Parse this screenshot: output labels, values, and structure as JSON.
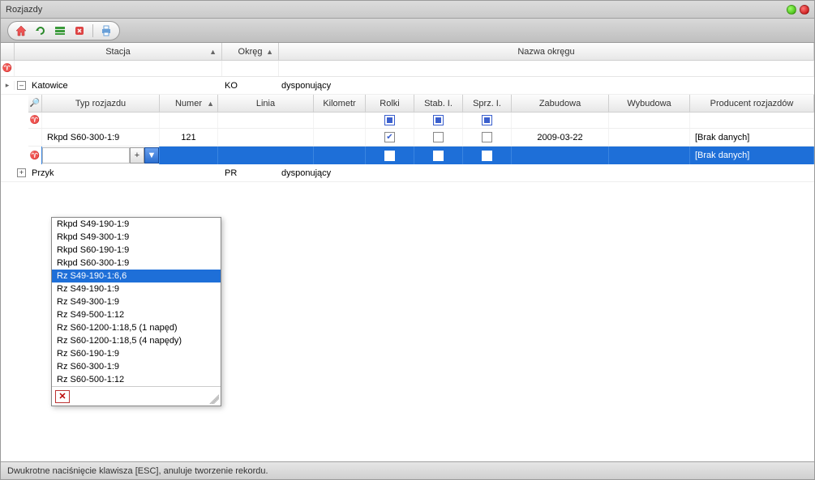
{
  "window": {
    "title": "Rozjazdy"
  },
  "outer_columns": {
    "stacja": "Stacja",
    "okreg": "Okręg",
    "nazwa": "Nazwa okręgu"
  },
  "groups": [
    {
      "label": "Katowice",
      "okreg": "KO",
      "nazwa": "dysponujący",
      "expanded": true
    },
    {
      "label": "Przyk",
      "okreg": "PR",
      "nazwa": "dysponujący",
      "expanded": false
    }
  ],
  "inner_columns": {
    "typ": "Typ rozjazdu",
    "numer": "Numer",
    "linia": "Linia",
    "km": "Kilometr",
    "rolki": "Rolki",
    "stab": "Stab. I.",
    "sprz": "Sprz. I.",
    "zabudowa": "Zabudowa",
    "wybudowa": "Wybudowa",
    "producent": "Producent rozjazdów"
  },
  "row1": {
    "typ": "Rkpd S60-300-1:9",
    "numer": "121",
    "linia": "",
    "km": "",
    "rolki": true,
    "stab": false,
    "sprz": false,
    "zabudowa": "2009-03-22",
    "wybudowa": "",
    "producent": "[Brak danych]"
  },
  "edit_row": {
    "producent": "[Brak danych]"
  },
  "dropdown": {
    "items": [
      "Rkpd S49-190-1:9",
      "Rkpd S49-300-1:9",
      "Rkpd S60-190-1:9",
      "Rkpd S60-300-1:9",
      "Rz S49-190-1:6,6",
      "Rz S49-190-1:9",
      "Rz S49-300-1:9",
      "Rz S49-500-1:12",
      "Rz S60-1200-1:18,5 (1 napęd)",
      "Rz S60-1200-1:18,5 (4 napędy)",
      "Rz S60-190-1:9",
      "Rz S60-300-1:9",
      "Rz S60-500-1:12"
    ],
    "selected_index": 4
  },
  "status": "Dwukrotne naciśnięcie klawisza [ESC], anuluje tworzenie rekordu.",
  "glyphs": {
    "sort_asc": "▲",
    "expand_plus": "+",
    "expand_minus": "–",
    "dd_arrow": "▼",
    "close_x": "✕",
    "filter": "⌕",
    "key": "🔑"
  }
}
